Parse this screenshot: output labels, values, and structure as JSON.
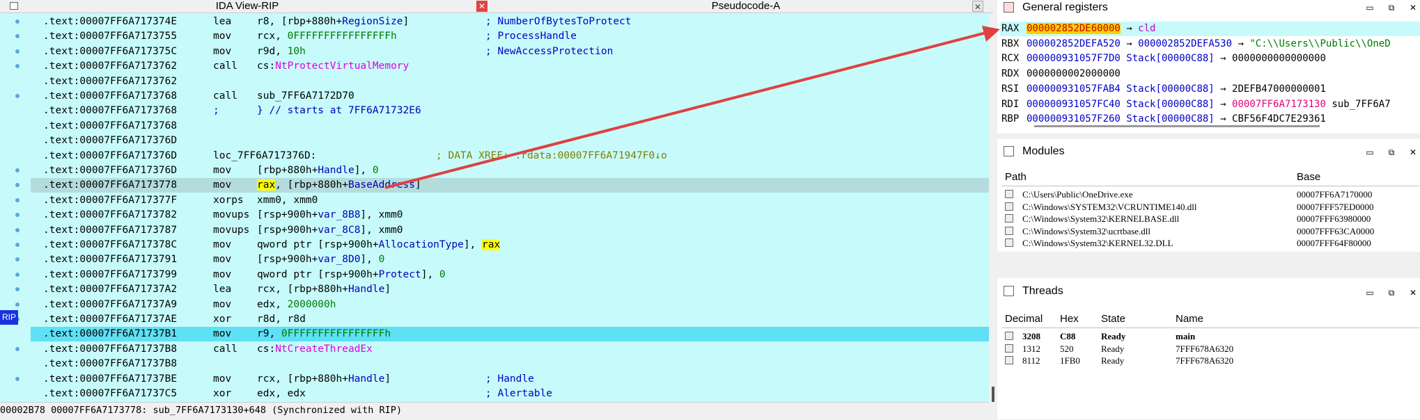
{
  "tabs": {
    "ida": "IDA View-RIP",
    "pseudo": "Pseudocode-A",
    "close": "✕"
  },
  "listing": [
    {
      "addr": ".text:00007FF6A717374E",
      "mn": "lea",
      "op1": "r8, [rbp+880h+",
      "op1b": "RegionSize",
      "op1c": "]",
      "comment": "; NumberOfBytesToProtect"
    },
    {
      "addr": ".text:00007FF6A7173755",
      "mn": "mov",
      "op1": "rcx, ",
      "num": "0FFFFFFFFFFFFFFFFh",
      "comment": "; ProcessHandle"
    },
    {
      "addr": ".text:00007FF6A717375C",
      "mn": "mov",
      "op1": "r9d, ",
      "num": "10h",
      "comment": "; NewAccessProtection"
    },
    {
      "addr": ".text:00007FF6A7173762",
      "mn": "call",
      "op1": "cs:",
      "func": "NtProtectVirtualMemory"
    },
    {
      "addr": ".text:00007FF6A7173762"
    },
    {
      "addr": ".text:00007FF6A7173768",
      "mn": "call",
      "op1": "sub_7FF6A7172D70"
    },
    {
      "addr": ".text:00007FF6A7173768",
      "mn": ";",
      "op1": "} // starts at 7FF6A71732E6",
      "isComment": true
    },
    {
      "addr": ".text:00007FF6A7173768"
    },
    {
      "addr": ".text:00007FF6A717376D"
    },
    {
      "addr": ".text:00007FF6A717376D",
      "label": "loc_7FF6A717376D:",
      "xref": "; DATA XREF: .rdata:00007FF6A71947F0↓o"
    },
    {
      "addr": ".text:00007FF6A717376D",
      "mn": "mov",
      "op1": "[rbp+880h+",
      "op1b": "Handle",
      "op1c": "], ",
      "num": "0"
    },
    {
      "addr": ".text:00007FF6A7173778",
      "mn": "mov",
      "hl": "rax",
      "op1": ", [rbp+880h+",
      "op1b": "BaseAddress",
      "op1c": "]"
    },
    {
      "addr": ".text:00007FF6A717377F",
      "mn": "xorps",
      "op1": "xmm0, xmm0"
    },
    {
      "addr": ".text:00007FF6A7173782",
      "mn": "movups",
      "op1": "[rsp+900h+",
      "op1b": "var_8B8",
      "op1c": "], xmm0"
    },
    {
      "addr": ".text:00007FF6A7173787",
      "mn": "movups",
      "op1": "[rsp+900h+",
      "op1b": "var_8C8",
      "op1c": "], xmm0"
    },
    {
      "addr": ".text:00007FF6A717378C",
      "mn": "mov",
      "op1": "qword ptr [rsp+900h+",
      "op1b": "AllocationType",
      "op1c": "], ",
      "hl2": "rax"
    },
    {
      "addr": ".text:00007FF6A7173791",
      "mn": "mov",
      "op1": "[rsp+900h+",
      "op1b": "var_8D0",
      "op1c": "], ",
      "num": "0"
    },
    {
      "addr": ".text:00007FF6A7173799",
      "mn": "mov",
      "op1": "qword ptr [rsp+900h+",
      "op1b": "Protect",
      "op1c": "], ",
      "num": "0"
    },
    {
      "addr": ".text:00007FF6A71737A2",
      "mn": "lea",
      "op1": "rcx, [rbp+880h+",
      "op1b": "Handle",
      "op1c": "]"
    },
    {
      "addr": ".text:00007FF6A71737A9",
      "mn": "mov",
      "op1": "edx, ",
      "num": "2000000h"
    },
    {
      "addr": ".text:00007FF6A71737AE",
      "mn": "xor",
      "op1": "r8d, r8d"
    },
    {
      "addr": ".text:00007FF6A71737B1",
      "mn": "mov",
      "op1": "r9, ",
      "num": "0FFFFFFFFFFFFFFFFh"
    },
    {
      "addr": ".text:00007FF6A71737B8",
      "mn": "call",
      "op1": "cs:",
      "func": "NtCreateThreadEx"
    },
    {
      "addr": ".text:00007FF6A71737B8"
    },
    {
      "addr": ".text:00007FF6A71737BE",
      "mn": "mov",
      "op1": "rcx, [rbp+880h+",
      "op1b": "Handle",
      "op1c": "]",
      "comment": "; Handle"
    },
    {
      "addr": ".text:00007FF6A71737C5",
      "mn": "xor",
      "op1": "edx, edx",
      "comment": "; Alertable"
    }
  ],
  "rip_label": "RIP",
  "status_bar": "00002B78 00007FF6A7173778: sub_7FF6A7173130+648 (Synchronized with RIP)",
  "registers": {
    "title": "General registers",
    "rows": [
      {
        "name": "RAX",
        "value": "000002852DE60000",
        "arrow": "→",
        "comment": "cld"
      },
      {
        "name": "RBX",
        "value": "000002852DEFA520",
        "arrow": "→",
        "value2": "000002852DEFA530",
        "arrow2": "→",
        "str": "\"C:\\\\Users\\\\Public\\\\OneD"
      },
      {
        "name": "RCX",
        "value": "000000931057F7D0",
        "stack": "Stack[00000C88]",
        "arrow": "→",
        "tail": "0000000000000000"
      },
      {
        "name": "RDX",
        "plain": "0000000002000000"
      },
      {
        "name": "RSI",
        "value": "000000931057FAB4",
        "stack": "Stack[00000C88]",
        "arrow": "→",
        "tail": "2DEFB47000000001"
      },
      {
        "name": "RDI",
        "value": "000000931057FC40",
        "stack": "Stack[00000C88]",
        "arrow": "→",
        "pink": "00007FF6A7173130",
        "tail": "sub_7FF6A7"
      },
      {
        "name": "RBP",
        "value": "000000931057F260",
        "stack": "Stack[00000C88]",
        "arrow": "→",
        "tail": "CBF56F4DC7E29361"
      }
    ]
  },
  "modules": {
    "title": "Modules",
    "col_path": "Path",
    "col_base": "Base",
    "rows": [
      {
        "path": "C:\\Users\\Public\\OneDrive.exe",
        "base": "00007FF6A7170000"
      },
      {
        "path": "C:\\Windows\\SYSTEM32\\VCRUNTIME140.dll",
        "base": "00007FFF57ED0000"
      },
      {
        "path": "C:\\Windows\\System32\\KERNELBASE.dll",
        "base": "00007FFF63980000"
      },
      {
        "path": "C:\\Windows\\System32\\ucrtbase.dll",
        "base": "00007FFF63CA0000"
      },
      {
        "path": "C:\\Windows\\System32\\KERNEL32.DLL",
        "base": "00007FFF64F80000"
      }
    ]
  },
  "threads": {
    "title": "Threads",
    "cols": [
      "Decimal",
      "Hex",
      "State",
      "Name"
    ],
    "rows": [
      {
        "decimal": "3208",
        "hex": "C88",
        "state": "Ready",
        "name": "main",
        "bold": true
      },
      {
        "decimal": "1312",
        "hex": "520",
        "state": "Ready",
        "name": "7FFF678A6320"
      },
      {
        "decimal": "8112",
        "hex": "1FB0",
        "state": "Ready",
        "name": "7FFF678A6320"
      }
    ]
  },
  "window_buttons": {
    "minimize": "▭",
    "float": "⧉",
    "close": "✕"
  },
  "colors": {
    "listing_bg": "#c7fbfb",
    "rip_line": "#5ee0f5",
    "arrow": "#e04040",
    "highlight": "#ffff00"
  }
}
